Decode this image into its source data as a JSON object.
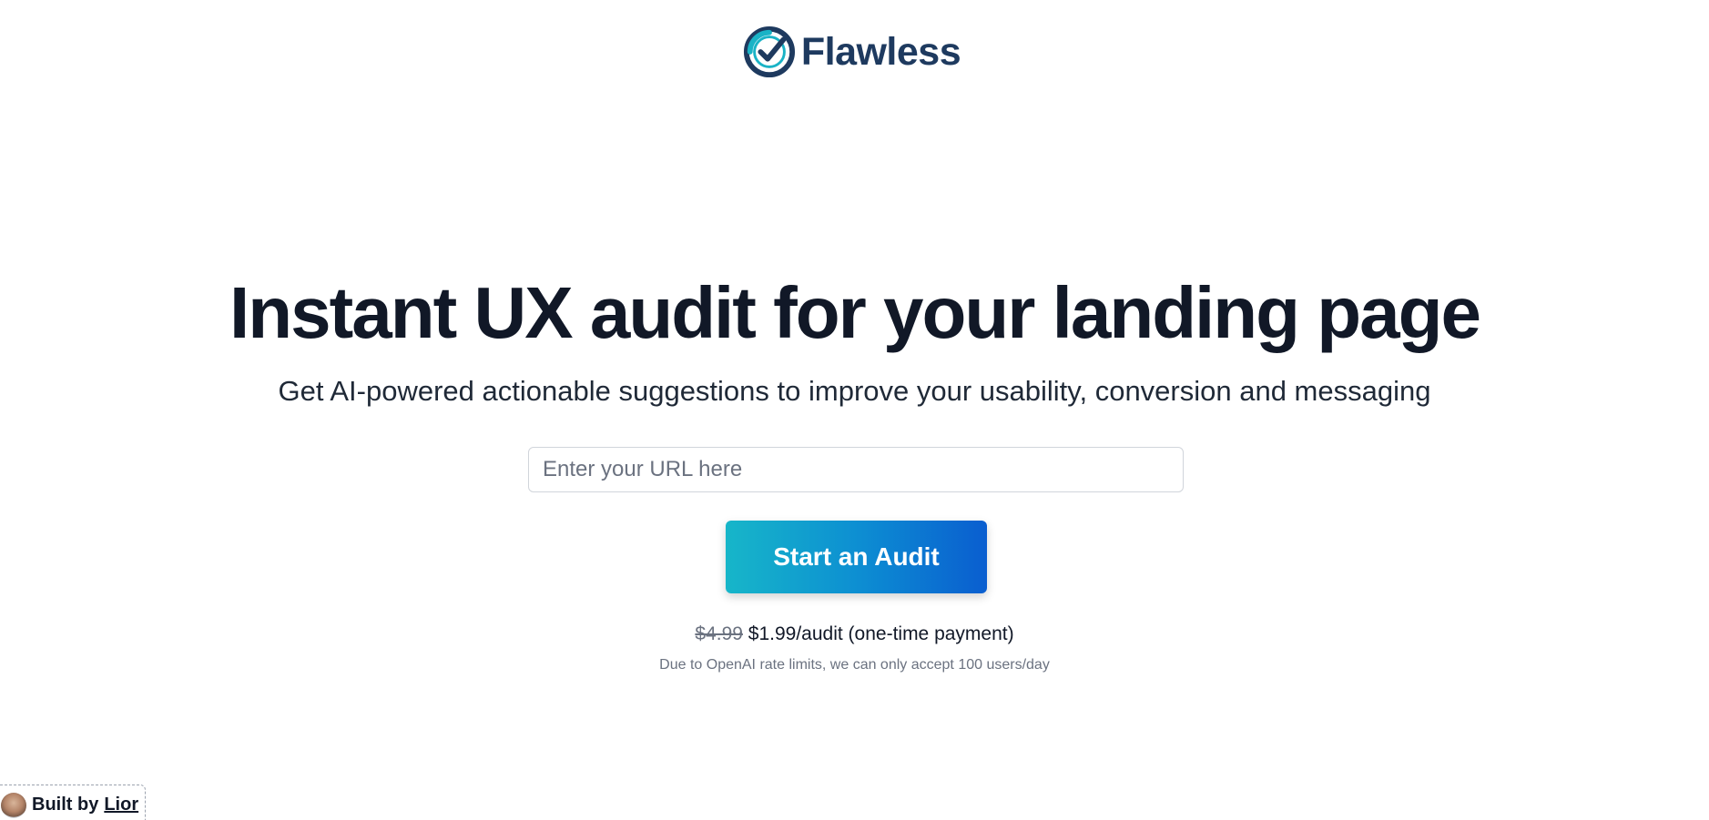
{
  "brand": {
    "name": "Flawless",
    "logo_icon": "check-badge-icon",
    "colors": {
      "text": "#1e3a5f",
      "ring_teal": "#1ab3c6",
      "ring_dark": "#1e3a5f"
    }
  },
  "hero": {
    "title": "Instant UX audit for your landing page",
    "subtitle": "Get AI-powered actionable suggestions to improve your usability, conversion and messaging"
  },
  "form": {
    "url_placeholder": "Enter your URL here",
    "url_value": "",
    "submit_label": "Start an Audit",
    "button_gradient": [
      "#17b6c9",
      "#0a5ed0"
    ]
  },
  "pricing": {
    "old_price": "$4.99",
    "new_price": "$1.99/audit (one-time payment)"
  },
  "notice": "Due to OpenAI rate limits, we can only accept 100 users/day",
  "built_by": {
    "prefix": "Built by",
    "name": "Lior"
  }
}
